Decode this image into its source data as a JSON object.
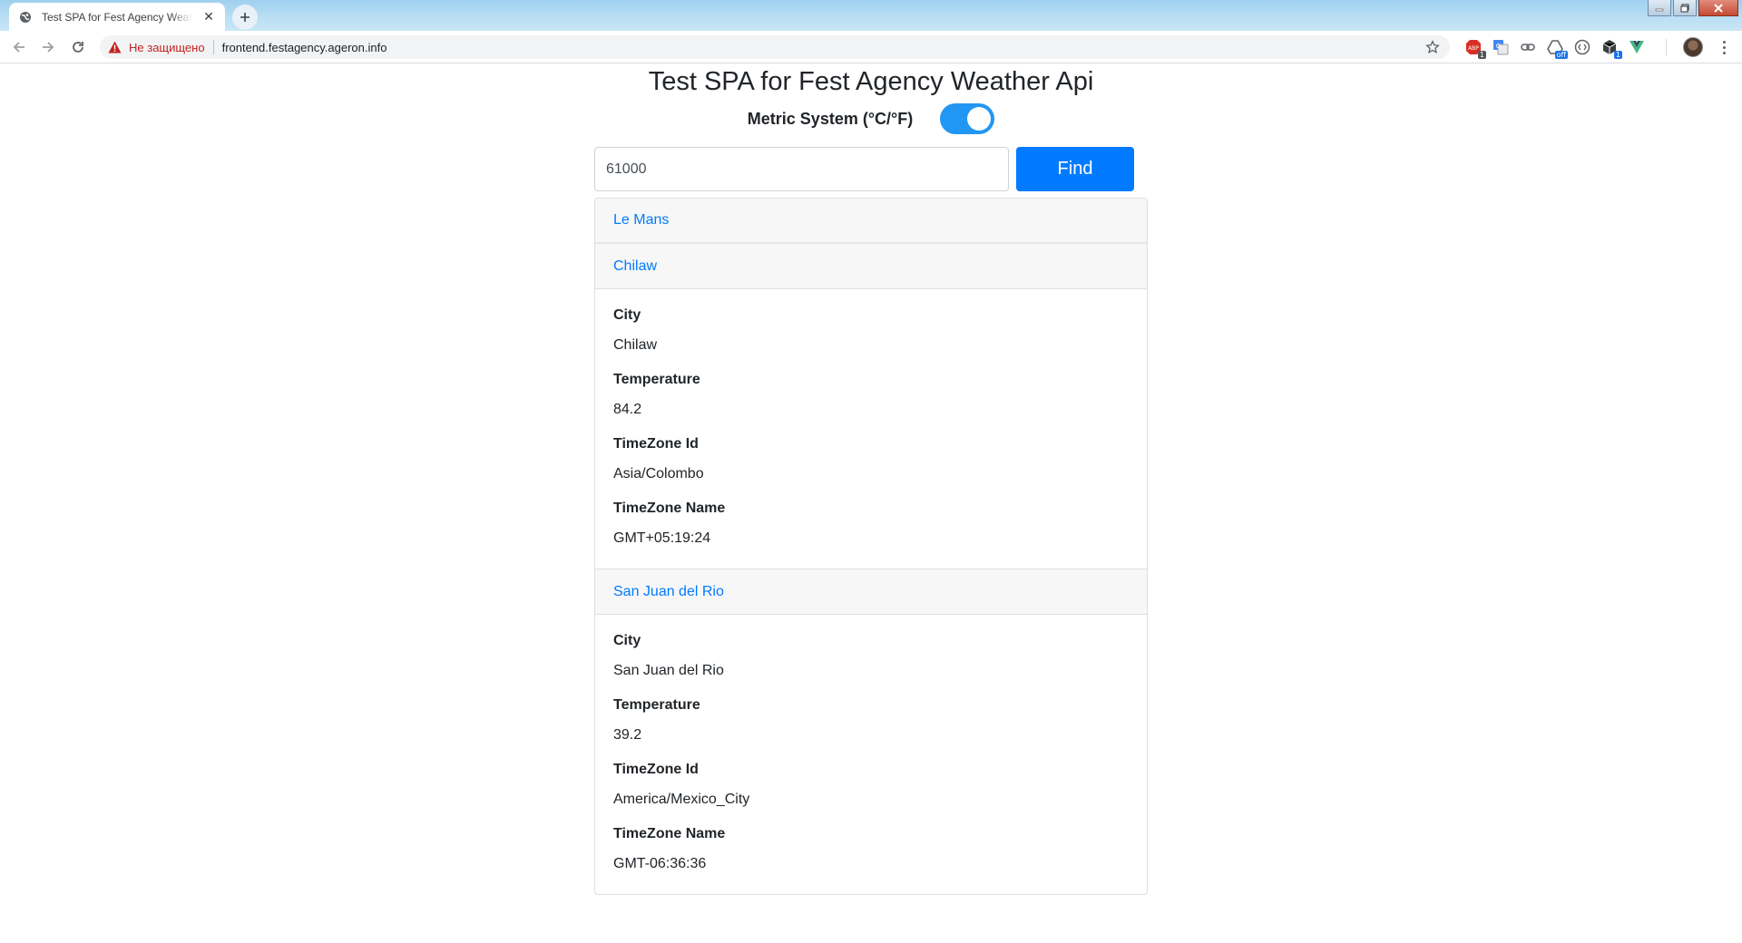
{
  "browser": {
    "tab_title": "Test SPA for Fest Agency Weather Api",
    "security_label": "Не защищено",
    "url": "frontend.festagency.ageron.info",
    "extensions": [
      {
        "icon": "adblock-icon",
        "badge": "1"
      },
      {
        "icon": "translate-icon",
        "badge": ""
      },
      {
        "icon": "link-icon",
        "badge": ""
      },
      {
        "icon": "drive-icon",
        "badge": "off"
      },
      {
        "icon": "code-icon",
        "badge": ""
      },
      {
        "icon": "package-icon",
        "badge": "1"
      },
      {
        "icon": "vue-icon",
        "badge": ""
      }
    ]
  },
  "page": {
    "title": "Test SPA for Fest Agency Weather Api",
    "metric_label": "Metric System (°C/°F)",
    "metric_enabled": true,
    "search_value": "61000",
    "find_label": "Find"
  },
  "cities": [
    {
      "header": "Le Mans"
    },
    {
      "header": "Chilaw",
      "details": [
        {
          "label": "City",
          "value": "Chilaw"
        },
        {
          "label": "Temperature",
          "value": "84.2"
        },
        {
          "label": "TimeZone Id",
          "value": "Asia/Colombo"
        },
        {
          "label": "TimeZone Name",
          "value": "GMT+05:19:24"
        }
      ]
    },
    {
      "header": "San Juan del Rio",
      "details": [
        {
          "label": "City",
          "value": "San Juan del Rio"
        },
        {
          "label": "Temperature",
          "value": "39.2"
        },
        {
          "label": "TimeZone Id",
          "value": "America/Mexico_City"
        },
        {
          "label": "TimeZone Name",
          "value": "GMT-06:36:36"
        }
      ]
    }
  ],
  "colors": {
    "accent": "#007bff",
    "toggle": "#2196f3",
    "warning": "#c5221f"
  }
}
